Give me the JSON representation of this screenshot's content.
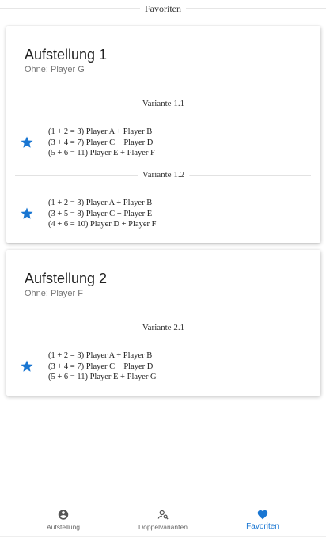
{
  "header": {
    "title": "Favoriten"
  },
  "cards": [
    {
      "title": "Aufstellung 1",
      "subtitle": "Ohne: Player G",
      "variants": [
        {
          "label": "Variante 1.1",
          "lines": [
            "(1 + 2 = 3) Player A + Player B",
            "(3 + 4 = 7) Player C + Player D",
            "(5 + 6 = 11) Player E + Player F"
          ]
        },
        {
          "label": "Variante 1.2",
          "lines": [
            "(1 + 2 = 3) Player A + Player B",
            "(3 + 5 = 8) Player C + Player E",
            "(4 + 6 = 10) Player D + Player F"
          ]
        }
      ]
    },
    {
      "title": "Aufstellung 2",
      "subtitle": "Ohne: Player F",
      "variants": [
        {
          "label": "Variante 2.1",
          "lines": [
            "(1 + 2 = 3) Player A + Player B",
            "(3 + 4 = 7) Player C + Player D",
            "(5 + 6 = 11) Player E + Player G"
          ]
        }
      ]
    }
  ],
  "bottom_nav": {
    "items": [
      {
        "label": "Aufstellung",
        "icon": "account-circle-icon"
      },
      {
        "label": "Doppelvarianten",
        "icon": "person-search-icon"
      },
      {
        "label": "Favoriten",
        "icon": "heart-icon",
        "active": true
      }
    ]
  },
  "colors": {
    "accent": "#1976d2",
    "star": "#1976d2"
  }
}
